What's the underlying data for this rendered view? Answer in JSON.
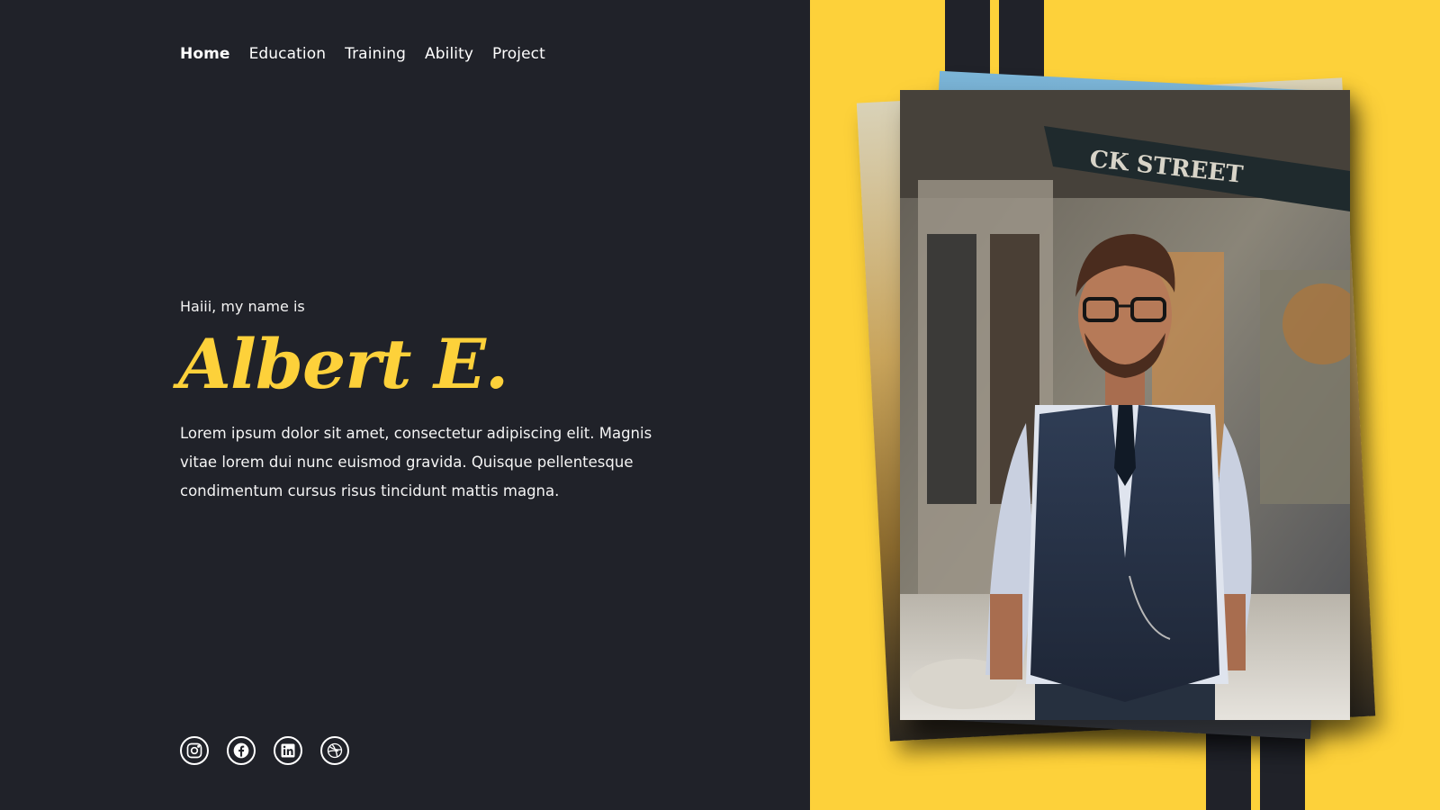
{
  "nav": {
    "items": [
      {
        "label": "Home",
        "active": true
      },
      {
        "label": "Education",
        "active": false
      },
      {
        "label": "Training",
        "active": false
      },
      {
        "label": "Ability",
        "active": false
      },
      {
        "label": "Project",
        "active": false
      }
    ]
  },
  "hero": {
    "greeting": "Haiii, my name is",
    "name": "Albert E.",
    "bio": "Lorem ipsum dolor sit amet, consectetur adipiscing elit. Magnis vitae lorem dui nunc euismod gravida. Quisque pellentesque condimentum cursus risus tincidunt mattis magna."
  },
  "photo": {
    "sign_text": "CK STREET"
  },
  "social": {
    "icons": [
      "instagram-icon",
      "facebook-icon",
      "linkedin-icon",
      "dribbble-icon"
    ]
  },
  "colors": {
    "background": "#202229",
    "accent": "#fdd13a",
    "text": "#ffffff"
  }
}
